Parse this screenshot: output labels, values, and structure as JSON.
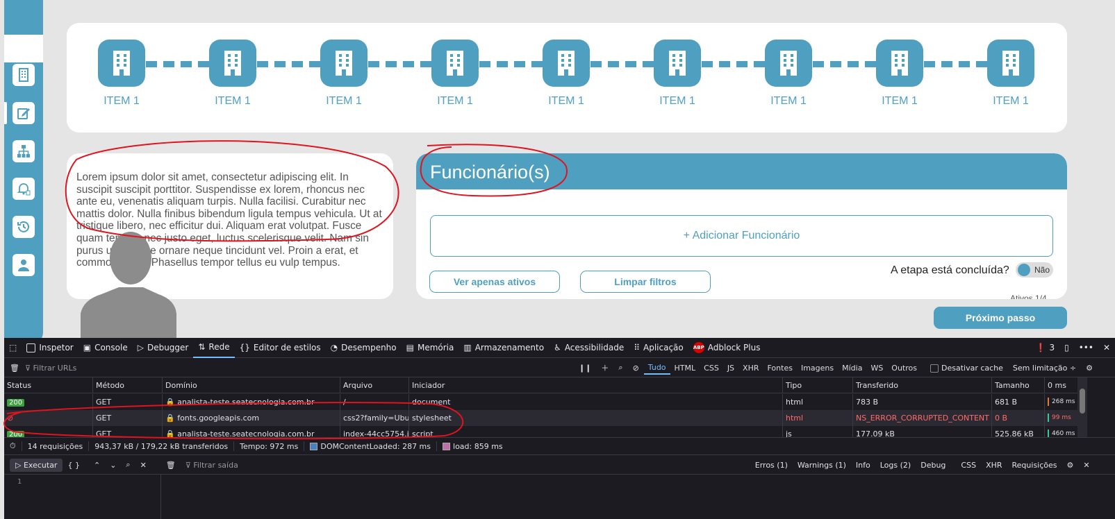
{
  "stepper": {
    "items": [
      {
        "label": "ITEM 1"
      },
      {
        "label": "ITEM 1"
      },
      {
        "label": "ITEM 1"
      },
      {
        "label": "ITEM 1"
      },
      {
        "label": "ITEM 1"
      },
      {
        "label": "ITEM 1"
      },
      {
        "label": "ITEM 1"
      },
      {
        "label": "ITEM 1"
      },
      {
        "label": "ITEM 1"
      }
    ]
  },
  "lorem": {
    "text": "Lorem ipsum dolor sit amet, consectetur adipiscing elit. In suscipit suscipit porttitor. Suspendisse ex lorem, rhoncus nec ante eu, venenatis aliquam turpis. Nulla facilisi. Curabitur nec mattis dolor. Nulla finibus bibendum ligula tempus vehicula. Ut at tristique libero, nec efficitur dui. Aliquam erat volutpat. Fusce quam tempus nec justo eget, luctus scelerisque velit. Nam sin purus urna, vitae ornare neque tincidunt vel. Proin a erat, et commodo felis. Phasellus tempor tellus eu vulp tempus."
  },
  "funcionarios": {
    "title": "Funcionário(s)",
    "add_label": "+ Adicionar Funcionário",
    "filter_active_label": "Ver apenas ativos",
    "clear_filters_label": "Limpar filtros",
    "stage_question": "A etapa está concluída?",
    "toggle_label": "Não",
    "count_text": "Ativos 1/4"
  },
  "next_button": "Próximo passo",
  "devtools": {
    "tabs": [
      "Inspetor",
      "Console",
      "Debugger",
      "Rede",
      "Editor de estilos",
      "Desempenho",
      "Memória",
      "Armazenamento",
      "Acessibilidade",
      "Aplicação",
      "Adblock Plus"
    ],
    "active_tab": "Rede",
    "error_count": "3",
    "abp_badge": "ABP",
    "filter_placeholder": "Filtrar URLs",
    "type_filters": [
      "Tudo",
      "HTML",
      "CSS",
      "JS",
      "XHR",
      "Fontes",
      "Imagens",
      "Mídia",
      "WS",
      "Outros"
    ],
    "disable_cache": "Desativar cache",
    "throttling": "Sem limitação ÷",
    "columns": [
      "Status",
      "Método",
      "Domínio",
      "Arquivo",
      "Iniciador",
      "Tipo",
      "Transferido",
      "Tamanho",
      "0 ms"
    ],
    "rows": [
      {
        "status": "200",
        "method": "GET",
        "domain": "analista-teste.seatecnologia.com.br",
        "file": "/",
        "initiator": "document",
        "type": "html",
        "transferred": "783 B",
        "size": "681 B",
        "time": "268 ms",
        "wf_color": "#e07a3a"
      },
      {
        "status": "blocked",
        "method": "GET",
        "domain": "fonts.googleapis.com",
        "file": "css2?family=Ubuntu",
        "initiator": "stylesheet",
        "type": "html",
        "transferred": "NS_ERROR_CORRUPTED_CONTENT",
        "size": "0 B",
        "time": "99 ms",
        "wf_color": "#3dc5a0"
      },
      {
        "status": "200",
        "method": "GET",
        "domain": "analista-teste.seatecnologia.com.br",
        "file": "index-44cc5754.js",
        "initiator": "script",
        "type": "js",
        "transferred": "177.09 kB",
        "size": "525.86 kB",
        "time": "460 ms",
        "wf_color": "#3dc5a0"
      }
    ],
    "summary": {
      "requests": "14 requisições",
      "transferred": "943,37 kB / 179,22 kB transferidos",
      "time": "Tempo: 972 ms",
      "dcl": "DOMContentLoaded: 287 ms",
      "load": "load: 859 ms"
    },
    "console": {
      "run_label": "Executar",
      "braces": "{ }",
      "filter_placeholder": "Filtrar saída",
      "levels": [
        "Erros (1)",
        "Warnings (1)",
        "Info",
        "Logs (2)",
        "Debug"
      ],
      "extra": [
        "CSS",
        "XHR",
        "Requisições"
      ],
      "line_number": "1"
    }
  },
  "colors": {
    "accent": "#4f9fc0",
    "devtools_bg": "#1c1b22",
    "annotation": "#e0141e"
  }
}
